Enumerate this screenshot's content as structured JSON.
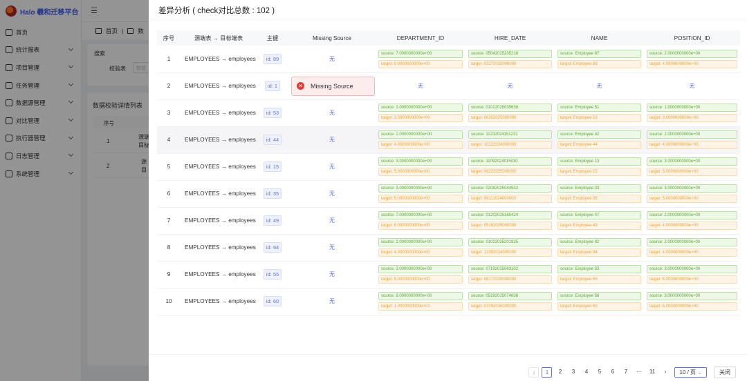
{
  "app": {
    "brand": "Halo 羲和迁移平台",
    "menu": [
      {
        "label": "首页",
        "has_children": false
      },
      {
        "label": "统计报表",
        "has_children": true
      },
      {
        "label": "项目管理",
        "has_children": true
      },
      {
        "label": "任务管理",
        "has_children": true
      },
      {
        "label": "数据源管理",
        "has_children": true
      },
      {
        "label": "对比管理",
        "has_children": true
      },
      {
        "label": "执行器管理",
        "has_children": true
      },
      {
        "label": "日志管理",
        "has_children": true
      },
      {
        "label": "系统管理",
        "has_children": true
      }
    ],
    "tabs": {
      "home": "首页",
      "current": "数"
    },
    "search": {
      "title": "搜索",
      "field_label": "校验表",
      "placeholder": "校验"
    },
    "list": {
      "title": "数据校验详情列表",
      "col_index": "序号",
      "rows": [
        {
          "index": "1",
          "text1": "源端",
          "text2": "目标"
        },
        {
          "index": "2",
          "text1": "源",
          "text2": "目"
        }
      ]
    }
  },
  "drawer": {
    "title": "差异分析 ( check对比总数 : 102 )",
    "columns": {
      "index": "序号",
      "tables": "源端表 → 目标端表",
      "pk": "主键",
      "missing": "Missing Source",
      "c1": "DEPARTMENT_ID",
      "c2": "HIRE_DATE",
      "c3": "NAME",
      "c4": "POSITION_ID"
    },
    "none_text": "无",
    "missing_label": "Missing Source",
    "rows": [
      {
        "index": "1",
        "tables": "EMPLOYEES → employees",
        "pk": "id: 89",
        "missing": false,
        "d_s": "source: 7.0000000000e+00",
        "d_t": "target: 9.0000000000e+00",
        "h_s": "source: 05042025235216",
        "h_t": "target: 02272025000000",
        "n_s": "source: Employee 87",
        "n_t": "target: Employee 89",
        "p_s": "source: 2.0000000000e+00",
        "p_t": "target: 4.0000000000e+00"
      },
      {
        "index": "2",
        "tables": "EMPLOYEES → employees",
        "pk": "id: 1",
        "missing": true
      },
      {
        "index": "3",
        "tables": "EMPLOYEES → employees",
        "pk": "id: 53",
        "missing": false,
        "d_s": "source: 1.0000000000e+00",
        "d_t": "target: 3.0000000000e+00",
        "h_s": "source: 01022025035636",
        "h_t": "target: 06152025000000",
        "n_s": "source: Employee 51",
        "n_t": "target: Employee 53",
        "p_s": "source: 1.0000000000e+00",
        "p_t": "target: 3.0000000000e+00"
      },
      {
        "index": "4",
        "tables": "EMPLOYEES → employees",
        "pk": "id: 44",
        "missing": false,
        "hover": true,
        "d_s": "source: 2.0000000000e+00",
        "d_t": "target: 4.0000000000e+00",
        "h_s": "source: 11232024151231",
        "h_t": "target: 10222024000000",
        "n_s": "source: Employee 42",
        "n_t": "target: Employee 44",
        "p_s": "source: 2.0000000000e+00",
        "p_t": "target: 4.0000000000e+00"
      },
      {
        "index": "5",
        "tables": "EMPLOYEES → employees",
        "pk": "id: 15",
        "missing": false,
        "d_s": "source: 3.0000000000e+00",
        "d_t": "target: 5.0000000000e+00",
        "h_s": "source: 11092024015030",
        "h_t": "target: 08222025000000",
        "n_s": "source: Employee 13",
        "n_t": "target: Employee 15",
        "p_s": "source: 3.0000000000e+00",
        "p_t": "target: 5.0000000000e+00"
      },
      {
        "index": "6",
        "tables": "EMPLOYEES → employees",
        "pk": "id: 35",
        "missing": false,
        "d_s": "source: 3.0000000000e+00",
        "d_t": "target: 5.0000000000e+00",
        "h_s": "source: 02082025044532",
        "h_t": "target: 09112024000000",
        "n_s": "source: Employee 33",
        "n_t": "target: Employee 35",
        "p_s": "source: 3.0000000000e+00",
        "p_t": "target: 5.0000000000e+00"
      },
      {
        "index": "7",
        "tables": "EMPLOYEES → employees",
        "pk": "id: 49",
        "missing": false,
        "d_s": "source: 7.0000000000e+00",
        "d_t": "target: 9.0000000000e+00",
        "h_s": "source: 01202025160424",
        "h_t": "target: 05162025000000",
        "n_s": "source: Employee 47",
        "n_t": "target: Employee 49",
        "p_s": "source: 2.0000000000e+00",
        "p_t": "target: 4.0000000000e+00"
      },
      {
        "index": "8",
        "tables": "EMPLOYEES → employees",
        "pk": "id: 94",
        "missing": false,
        "d_s": "source: 2.0000000000e+00",
        "d_t": "target: 4.0000000000e+00",
        "h_s": "source: 01022025201925",
        "h_t": "target: 12302024000000",
        "n_s": "source: Employee 92",
        "n_t": "target: Employee 94",
        "p_s": "source: 2.0000000000e+00",
        "p_t": "target: 4.0000000000e+00"
      },
      {
        "index": "9",
        "tables": "EMPLOYEES → employees",
        "pk": "id: 55",
        "missing": false,
        "d_s": "source: 3.0000000000e+00",
        "d_t": "target: 5.0000000000e+00",
        "h_s": "source: 07192025063102",
        "h_t": "target: 06172025000000",
        "n_s": "source: Employee 53",
        "n_t": "target: Employee 55",
        "p_s": "source: 3.0000000000e+00",
        "p_t": "target: 5.0000000000e+00"
      },
      {
        "index": "10",
        "tables": "EMPLOYEES → employees",
        "pk": "id: 60",
        "missing": false,
        "d_s": "source: 8.0000000000e+00",
        "d_t": "target: 1.0000000000e+01",
        "h_s": "source: 05192025074838",
        "h_t": "target: 07092025000000",
        "n_s": "source: Employee 58",
        "n_t": "target: Employee 60",
        "p_s": "source: 3.0000000000e+00",
        "p_t": "target: 5.0000000000e+00"
      }
    ],
    "pagination": {
      "prev": "‹",
      "pages": [
        "1",
        "2",
        "3",
        "4",
        "5",
        "6",
        "7",
        "···",
        "11"
      ],
      "current": "1",
      "next": "›",
      "page_size": "10 / 页",
      "close": "关闭"
    }
  },
  "colors": {
    "accent": "#5b6ef0",
    "source_tag": "#5aaa2c",
    "target_tag": "#f0a030",
    "missing_bg": "#fdecec",
    "error": "#e53935"
  }
}
